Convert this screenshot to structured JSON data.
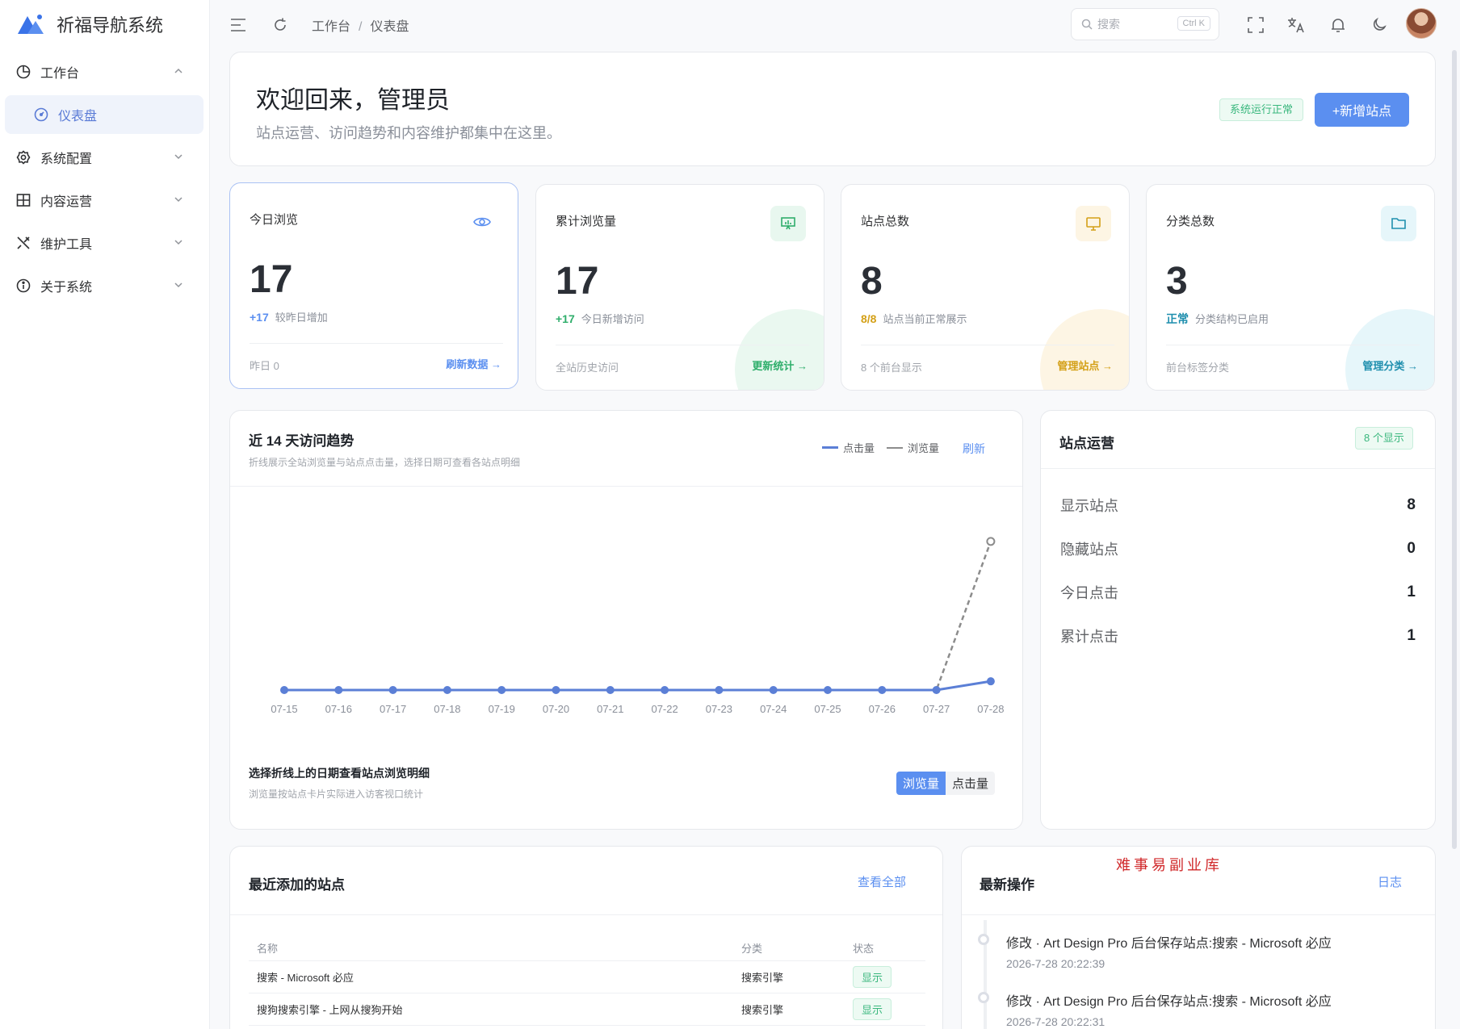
{
  "app": {
    "title": "祈福导航系统"
  },
  "sidebar": {
    "items": [
      {
        "label": "工作台",
        "icon": "pie-chart-icon",
        "expanded": true
      },
      {
        "label": "系统配置",
        "icon": "gear-icon"
      },
      {
        "label": "内容运营",
        "icon": "grid-icon"
      },
      {
        "label": "维护工具",
        "icon": "tools-icon"
      },
      {
        "label": "关于系统",
        "icon": "info-icon"
      }
    ],
    "active_sub": {
      "label": "仪表盘",
      "icon": "dashboard-icon"
    }
  },
  "topbar": {
    "breadcrumb": [
      "工作台",
      "仪表盘"
    ],
    "search_placeholder": "搜索",
    "search_shortcut": "Ctrl K"
  },
  "welcome": {
    "title": "欢迎回来，管理员",
    "subtitle": "站点运营、访问趋势和内容维护都集中在这里。",
    "status_badge": "系统运行正常",
    "add_button": "+新增站点"
  },
  "stats": [
    {
      "title": "今日浏览",
      "value": "17",
      "delta": "+17",
      "delta_text": "较昨日增加",
      "foot": "昨日 0",
      "link": "刷新数据 →",
      "accent": "#5b8ff0",
      "icon": "eye-icon"
    },
    {
      "title": "累计浏览量",
      "value": "17",
      "delta": "+17",
      "delta_text": "今日新增访问",
      "foot": "全站历史访问",
      "link": "更新统计 →",
      "accent": "#2fae6b",
      "icon": "presentation-icon"
    },
    {
      "title": "站点总数",
      "value": "8",
      "delta": "8/8",
      "delta_text": "站点当前正常展示",
      "foot": "8 个前台显示",
      "link": "管理站点 →",
      "accent": "#d4a017",
      "icon": "monitor-icon"
    },
    {
      "title": "分类总数",
      "value": "3",
      "delta": "正常",
      "delta_text": "分类结构已启用",
      "foot": "前台标签分类",
      "link": "管理分类 →",
      "accent": "#1f8fae",
      "icon": "folder-icon"
    }
  ],
  "trend": {
    "title": "近 14 天访问趋势",
    "subtitle": "折线展示全站浏览量与站点点击量，选择日期可查看各站点明细",
    "legend": [
      "点击量",
      "浏览量"
    ],
    "refresh": "刷新",
    "detail_title": "选择折线上的日期查看站点浏览明细",
    "detail_sub": "浏览量按站点卡片实际进入访客视口统计",
    "toggle": [
      "浏览量",
      "点击量"
    ]
  },
  "chart_data": {
    "type": "line",
    "x": [
      "07-15",
      "07-16",
      "07-17",
      "07-18",
      "07-19",
      "07-20",
      "07-21",
      "07-22",
      "07-23",
      "07-24",
      "07-25",
      "07-26",
      "07-27",
      "07-28"
    ],
    "series": [
      {
        "name": "点击量",
        "values": [
          0,
          0,
          0,
          0,
          0,
          0,
          0,
          0,
          0,
          0,
          0,
          0,
          0,
          1
        ],
        "color": "#5b7fd6"
      },
      {
        "name": "浏览量",
        "values": [
          0,
          0,
          0,
          0,
          0,
          0,
          0,
          0,
          0,
          0,
          0,
          0,
          0,
          17
        ],
        "color": "#8c8c8c"
      }
    ],
    "ylim": [
      0,
      18
    ]
  },
  "ops": {
    "title": "站点运营",
    "chip": "8 个显示",
    "rows": [
      {
        "label": "显示站点",
        "value": "8"
      },
      {
        "label": "隐藏站点",
        "value": "0"
      },
      {
        "label": "今日点击",
        "value": "1"
      },
      {
        "label": "累计点击",
        "value": "1"
      }
    ]
  },
  "recent": {
    "title": "最近添加的站点",
    "link": "查看全部",
    "headers": [
      "名称",
      "分类",
      "状态"
    ],
    "rows": [
      {
        "name": "搜索 - Microsoft 必应",
        "category": "搜索引擎",
        "status": "显示"
      },
      {
        "name": "搜狗搜索引擎 - 上网从搜狗开始",
        "category": "搜索引擎",
        "status": "显示"
      }
    ]
  },
  "activity": {
    "title": "最新操作",
    "link": "日志",
    "items": [
      {
        "text": "修改 · Art Design Pro 后台保存站点:搜索 - Microsoft 必应",
        "time": "2026-7-28 20:22:39"
      },
      {
        "text": "修改 · Art Design Pro 后台保存站点:搜索 - Microsoft 必应",
        "time": "2026-7-28 20:22:31"
      }
    ]
  },
  "watermark": "难事易副业库"
}
